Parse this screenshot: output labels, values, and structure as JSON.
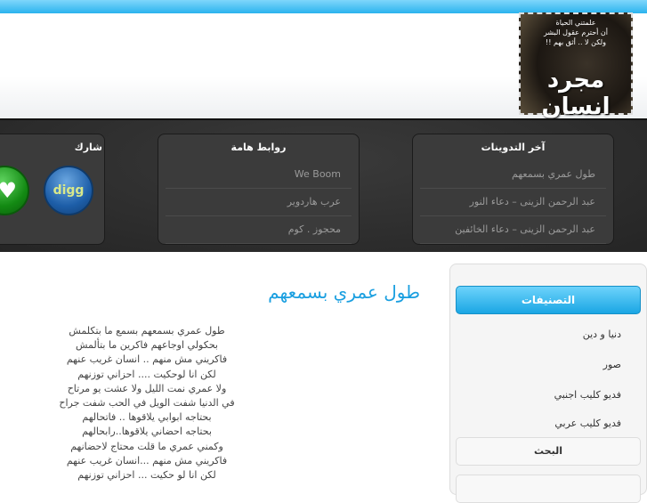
{
  "logo": {
    "quote": [
      "علمتني الحياة",
      "أن أحترم عقول البشر",
      "ولكن لا .. أثق بهم !!"
    ],
    "name": "مجرد انسان"
  },
  "panels": {
    "latest": {
      "title": "آخر التدوينات",
      "items": [
        "طول عمري بسمعهم",
        "عبد الرحمن الزينى – دعاء النور",
        "عبد الرحمن الزينى – دعاء الخائفين"
      ]
    },
    "links": {
      "title": "روابط هامة",
      "items": [
        "We Boom",
        "عرب هاردوير",
        "محجوز . كوم"
      ]
    },
    "share": {
      "title": "شارك",
      "digg": "digg"
    }
  },
  "post": {
    "title": "طول عمري بسمعهم",
    "lines": [
      "طول عمري بسمعهم بسمع ما بتكلمش",
      "بحكولي اوجاعهم فاكرين ما بتألمش",
      "فاكريني مش منهم .. انسان غريب عنهم",
      "لكن انا لوحكيت .... احزاني توزنهم",
      "ولا عمري نمت الليل ولا عشت يو مرتاح",
      "في الدنيا شفت الويل في الحب شفت جراح",
      "بحتاجه ابوابي يلاقوها .. فاتحالهم",
      "بحتاجه احضاني يلاقوها..رابحالهم",
      "وكمني عمري ما قلت محتاج لاحضانهم",
      "فاكريني مش منهم ...انسان غريب عنهم",
      "لكن انا لو حكيت ... احزاني توزنهم"
    ]
  },
  "sidebar": {
    "categories_title": "التصنيفات",
    "categories": [
      "دنيا و دين",
      "صور",
      "فديو كليب اجنبي",
      "فديو كليب عربي"
    ],
    "search_title": "البحث"
  }
}
